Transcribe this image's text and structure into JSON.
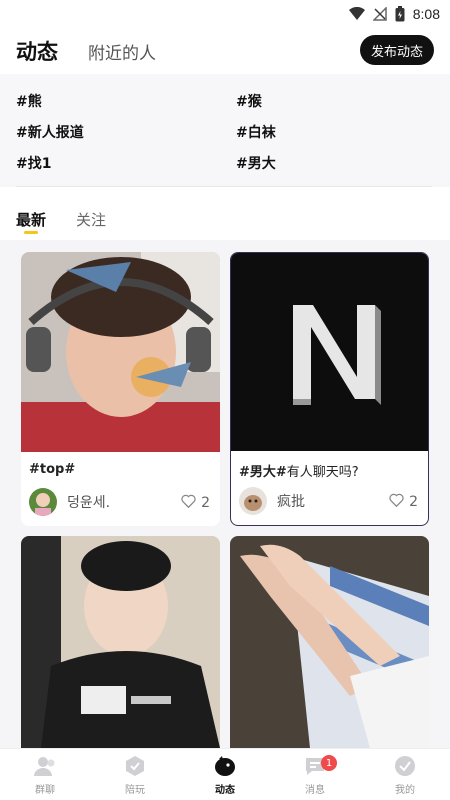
{
  "status_bar": {
    "time": "8:08"
  },
  "header": {
    "tab_active": "动态",
    "tab_nearby": "附近的人",
    "publish_label": "发布动态"
  },
  "topics": [
    "#熊",
    "#猴",
    "#新人报道",
    "#白袜",
    "#找1",
    "#男大"
  ],
  "feed_tabs": {
    "latest": "最新",
    "follow": "关注"
  },
  "posts": [
    {
      "tags": "#top#",
      "text": "",
      "author": "덩윤세.",
      "likes": "2"
    },
    {
      "tags": "#男大#",
      "text": "有人聊天吗?",
      "author": "疯批",
      "likes": "2"
    },
    {
      "tags": "",
      "text": "",
      "author": "",
      "likes": ""
    },
    {
      "tags": "",
      "text": "",
      "author": "",
      "likes": ""
    }
  ],
  "bottom_nav": {
    "items": [
      {
        "label": "群聊",
        "icon": "people-icon"
      },
      {
        "label": "陪玩",
        "icon": "play-companion-icon"
      },
      {
        "label": "动态",
        "icon": "moments-icon"
      },
      {
        "label": "消息",
        "icon": "message-icon",
        "badge": "1"
      },
      {
        "label": "我的",
        "icon": "profile-icon"
      }
    ]
  },
  "colors": {
    "accent_indicator": "#f5c518",
    "badge_red": "#f04a4a",
    "dark": "#111111"
  }
}
